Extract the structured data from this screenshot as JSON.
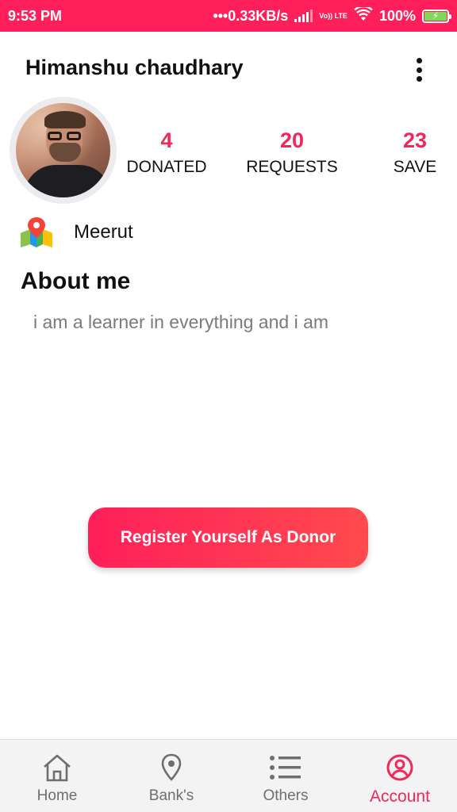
{
  "status_bar": {
    "time": "9:53 PM",
    "network_speed": "•••0.33KB/s",
    "network_type": "Vo)) LTE",
    "battery": "100%",
    "icons": [
      "signal-icon",
      "wifi-icon",
      "battery-charging-icon"
    ]
  },
  "profile": {
    "name": "Himanshu chaudhary",
    "menu_icon": "more-vertical-icon"
  },
  "stats": {
    "donated": {
      "value": "4",
      "label": "DONATED"
    },
    "requests": {
      "value": "20",
      "label": "REQUESTS"
    },
    "save": {
      "value": "23",
      "label": "SAVE"
    }
  },
  "location": {
    "icon": "map-pin-icon",
    "city": "Meerut"
  },
  "about": {
    "heading": "About me",
    "text": "i am a learner in everything and i am"
  },
  "register_button": {
    "label": "Register Yourself As Donor"
  },
  "bottom_nav": {
    "items": [
      {
        "label": "Home",
        "icon": "home-icon",
        "active": false
      },
      {
        "label": "Bank's",
        "icon": "location-pin-icon",
        "active": false
      },
      {
        "label": "Others",
        "icon": "list-icon",
        "active": false
      },
      {
        "label": "Account",
        "icon": "account-circle-icon",
        "active": true
      }
    ]
  },
  "colors": {
    "accent": "#f0285a",
    "status_bar": "#ff1f5a",
    "inactive": "#6e6e6e"
  }
}
